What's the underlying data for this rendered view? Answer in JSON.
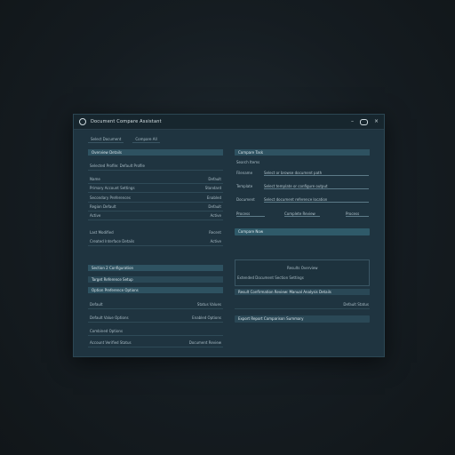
{
  "window": {
    "title": "Document Compare Assistant",
    "minimize_label": "–",
    "close_label": "×"
  },
  "toolbar": {
    "items": [
      "Select Document",
      "Compare All"
    ]
  },
  "left_top": {
    "header": "Overview Details",
    "subheader": "Selected Profile: Default Profile",
    "rows": [
      {
        "label": "Name",
        "value": "Default"
      },
      {
        "label": "Primary Account Settings",
        "value": "Standard"
      },
      {
        "label": "Secondary Preferences",
        "value": "Enabled"
      },
      {
        "label": "Region Default",
        "value": "Default"
      },
      {
        "label": "Active",
        "value": "Active"
      },
      {
        "label": "Last Modified",
        "value": "Recent"
      },
      {
        "label": "Created Interface Details",
        "value": "Active"
      }
    ]
  },
  "left_bottom": {
    "header": "Section 2 Configuration",
    "sub1": "Target Reference Setup",
    "sub2": "Option Preference Options",
    "rows": [
      {
        "label": "Default",
        "value": "Status Values"
      },
      {
        "label": "Default Value Options",
        "value": "Enabled Options"
      },
      {
        "label": "Combined Options",
        "value": ""
      },
      {
        "label": "Account Verified Status",
        "value": "Document Review"
      }
    ]
  },
  "right_top": {
    "header": "Compare Task",
    "subheader": "Search Items",
    "fields": [
      {
        "label": "Filename",
        "value": "Select or browse document path"
      },
      {
        "label": "Template",
        "value": "Select template or configure output"
      },
      {
        "label": "Document",
        "value": "Select document reference location"
      }
    ],
    "combo": {
      "left": "Process",
      "mid": "Complete Review",
      "right": "Process"
    },
    "action": "Compare Now"
  },
  "right_bottom": {
    "panel_title": "Results Overview",
    "panel_line": "Extended Document Section Settings",
    "summary": "Result Confirmation Review: Manual Analysis Details",
    "status": "Default Status",
    "button": "Export Report Comparison Summary"
  }
}
